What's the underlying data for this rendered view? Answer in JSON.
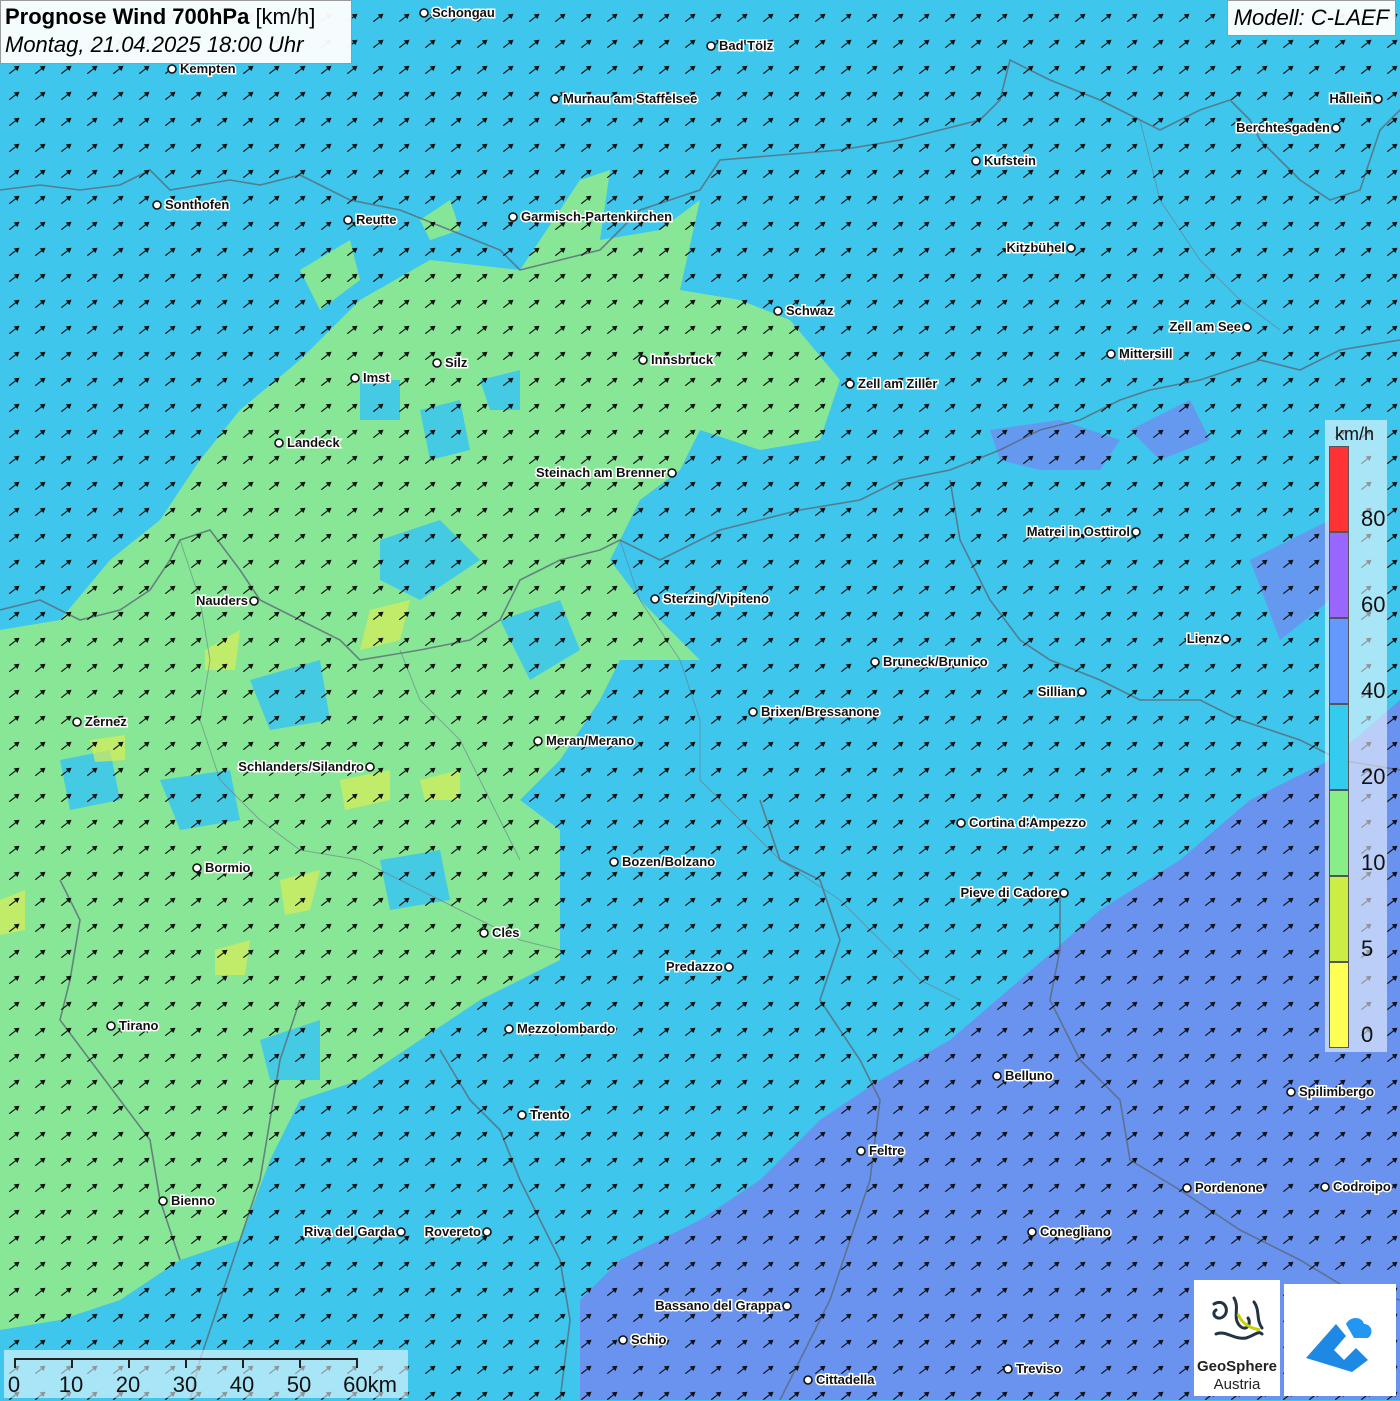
{
  "header": {
    "title": "Prognose Wind 700hPa",
    "title_unit": "[km/h]",
    "subtitle": "Montag, 21.04.2025 18:00 Uhr",
    "model": "Modell: C-LAEF"
  },
  "legend": {
    "unit": "km/h",
    "bins": [
      {
        "label": "80",
        "color": "#ff3333"
      },
      {
        "label": "60",
        "color": "#9966ff"
      },
      {
        "label": "40",
        "color": "#6699ff"
      },
      {
        "label": "20",
        "color": "#33ccee"
      },
      {
        "label": "10",
        "color": "#88ee88"
      },
      {
        "label": "5",
        "color": "#ccee44"
      },
      {
        "label": "0",
        "color": "#ffff55"
      }
    ]
  },
  "scale_bar": {
    "labels": [
      "0",
      "10",
      "20",
      "30",
      "40",
      "50",
      "60km"
    ]
  },
  "logo": {
    "line1": "GeoSphere",
    "line2": "Austria"
  },
  "cities": [
    {
      "name": "Schongau"
    },
    {
      "name": "Bad Tölz"
    },
    {
      "name": "Kempten"
    },
    {
      "name": "Murnau am Staffelsee"
    },
    {
      "name": "Hallein"
    },
    {
      "name": "Berchtesgaden"
    },
    {
      "name": "Kufstein"
    },
    {
      "name": "Sonthofen"
    },
    {
      "name": "Reutte"
    },
    {
      "name": "Garmisch-Partenkirchen"
    },
    {
      "name": "Kitzbühel"
    },
    {
      "name": "Schwaz"
    },
    {
      "name": "Zell am See"
    },
    {
      "name": "Innsbruck"
    },
    {
      "name": "Silz"
    },
    {
      "name": "Mittersill"
    },
    {
      "name": "Imst"
    },
    {
      "name": "Zell am Ziller"
    },
    {
      "name": "Landeck"
    },
    {
      "name": "Steinach am Brenner"
    },
    {
      "name": "Matrei in Osttirol"
    },
    {
      "name": "Nauders"
    },
    {
      "name": "Sterzing/Vipiteno"
    },
    {
      "name": "Lienz"
    },
    {
      "name": "Bruneck/Brunico"
    },
    {
      "name": "Sillian"
    },
    {
      "name": "Brixen/Bressanone"
    },
    {
      "name": "Zernez"
    },
    {
      "name": "Meran/Merano"
    },
    {
      "name": "Schlanders/Silandro"
    },
    {
      "name": "Cortina d'Ampezzo"
    },
    {
      "name": "Bozen/Bolzano"
    },
    {
      "name": "Bormio"
    },
    {
      "name": "Pieve di Cadore"
    },
    {
      "name": "Cles"
    },
    {
      "name": "Predazzo"
    },
    {
      "name": "Tirano"
    },
    {
      "name": "Mezzolombardo"
    },
    {
      "name": "Belluno"
    },
    {
      "name": "Spilimbergo"
    },
    {
      "name": "Trento"
    },
    {
      "name": "Feltre"
    },
    {
      "name": "Pordenone"
    },
    {
      "name": "Codroipo"
    },
    {
      "name": "Bienno"
    },
    {
      "name": "Riva del Garda"
    },
    {
      "name": "Rovereto"
    },
    {
      "name": "Conegliano"
    },
    {
      "name": "Bassano del Grappa"
    },
    {
      "name": "Schio"
    },
    {
      "name": "Treviso"
    },
    {
      "name": "Cittadella"
    }
  ]
}
